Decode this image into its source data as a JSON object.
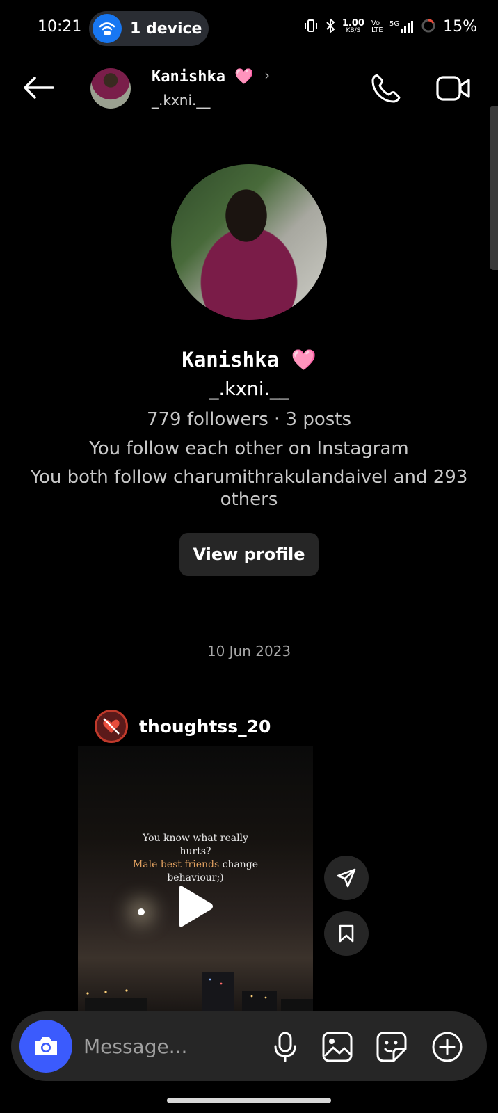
{
  "status_bar": {
    "time": "10:21",
    "device_pill": "1 device",
    "net_speed_value": "1.00",
    "net_speed_unit": "KB/S",
    "volte": "Vo LTE",
    "signal": "5G",
    "battery": "15%"
  },
  "header": {
    "name": "Kanishka 🩷",
    "chevron": "›",
    "handle": "_.kxni.__"
  },
  "profile": {
    "name": "Kanishka 🩷",
    "handle": "_.kxni.__",
    "stats": "779 followers · 3 posts",
    "mutual": "You follow each other on Instagram",
    "both_follow": "You both follow charumithrakulandaivel and 293 others",
    "view_profile_label": "View profile"
  },
  "date_separator": "10 Jun 2023",
  "shared_post": {
    "author": "thoughtss_20",
    "caption_line1": "You know what really",
    "caption_line2": "hurts?",
    "caption_highlight": "Male best friends",
    "caption_line3_rest": " change",
    "caption_line4": "behaviour;)"
  },
  "composer": {
    "placeholder": "Message..."
  },
  "colors": {
    "background": "#000000",
    "accent": "#3b5bfd",
    "device_pill": "#1877f2",
    "surface": "#262626"
  },
  "icons": [
    "back-arrow-icon",
    "phone-icon",
    "video-camera-icon",
    "wifi-icon",
    "play-icon",
    "send-icon",
    "bookmark-icon",
    "camera-icon",
    "microphone-icon",
    "gallery-icon",
    "sticker-icon",
    "plus-icon"
  ]
}
